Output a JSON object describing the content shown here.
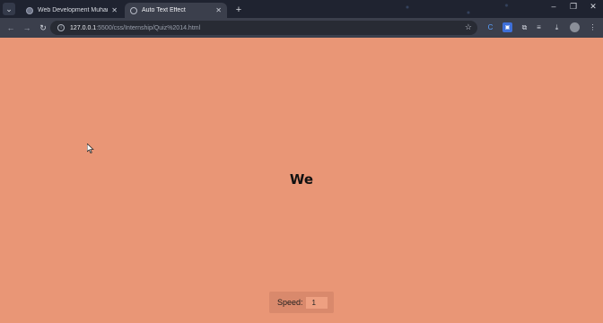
{
  "browser": {
    "tabs": [
      {
        "title": "Web Development Muhammad",
        "active": false
      },
      {
        "title": "Auto Text Effect",
        "active": true
      }
    ],
    "new_tab_symbol": "+",
    "window_controls": {
      "minimize": "–",
      "maximize": "❐",
      "close": "✕"
    },
    "url": {
      "host": "127.0.0.1",
      "path": ":5500/css/Internship/Quiz%2014.html"
    }
  },
  "page": {
    "word": "We",
    "speed_label": "Speed:",
    "speed_value": "1",
    "background": "#e99676"
  },
  "icons": {
    "back": "arrow-left-icon",
    "forward": "arrow-right-icon",
    "reload": "reload-icon",
    "star": "bookmark-star-icon",
    "download": "download-icon"
  }
}
